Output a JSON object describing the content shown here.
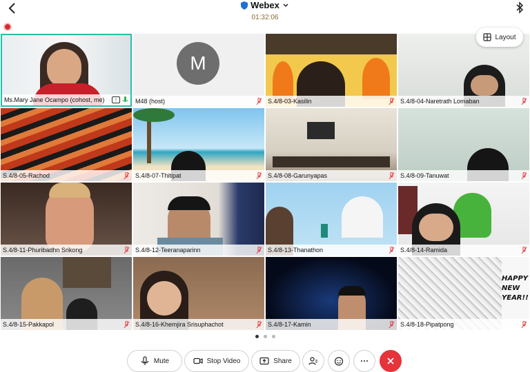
{
  "header": {
    "app_title": "Webex",
    "timer": "01:32:06"
  },
  "layout_button": {
    "label": "Layout"
  },
  "participants": [
    {
      "name": "Ms.Mary Jane Ocampo (cohost, me)"
    },
    {
      "name": "M48 (host)",
      "avatar_letter": "M"
    },
    {
      "name": "S.4/8-03-Kasilin"
    },
    {
      "name": "S.4/8-04-Naretrath Lomaban"
    },
    {
      "name": "S.4/8-05-Rachod"
    },
    {
      "name": "S.4/8-07-Thitipat"
    },
    {
      "name": "S.4/8-08-Garunyapas"
    },
    {
      "name": "S.4/8-09-Tanuwat"
    },
    {
      "name": "S.4/8-11-Phuribadhn Srikong"
    },
    {
      "name": "S.4/8-12-Teeranaparinn"
    },
    {
      "name": "S.4/8-13-Thanathon"
    },
    {
      "name": "S.4/8-14-Ramida"
    },
    {
      "name": "S.4/8-15-Pakkapol"
    },
    {
      "name": "S.4/8-16-Khemjira Srisuphachot"
    },
    {
      "name": "S.4/8-17-Kamin"
    },
    {
      "name": "S.4/8-18-Pipatpong"
    }
  ],
  "controls": {
    "mute": "Mute",
    "stop_video": "Stop Video",
    "share": "Share"
  },
  "colors": {
    "active_border": "#25c0a7",
    "end_call": "#e5343a",
    "muted_icon": "#e5343a"
  },
  "pagination": {
    "pages": 3,
    "current": 1
  }
}
